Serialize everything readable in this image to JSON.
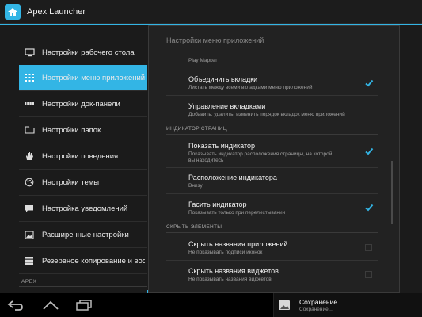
{
  "app": {
    "title": "Apex Launcher"
  },
  "sidebar": {
    "items": [
      {
        "label": "Настройки рабочего стола",
        "icon": "monitor-icon"
      },
      {
        "label": "Настройки меню приложений",
        "icon": "grid-icon"
      },
      {
        "label": "Настройки док-панели",
        "icon": "dock-icon"
      },
      {
        "label": "Настройки папок",
        "icon": "folder-icon"
      },
      {
        "label": "Настройки поведения",
        "icon": "hand-icon"
      },
      {
        "label": "Настройки темы",
        "icon": "palette-icon"
      },
      {
        "label": "Настройка уведомлений",
        "icon": "chat-bubble-icon"
      },
      {
        "label": "Расширенные настройки",
        "icon": "image-icon"
      },
      {
        "label": "Резервное копирование и восс",
        "icon": "storage-icon"
      }
    ],
    "section": "APEX"
  },
  "panel": {
    "title": "Настройки меню приложений",
    "prev_summary": "Play Маркет",
    "items": {
      "merge_tabs": {
        "title": "Объединить вкладки",
        "summary": "Листать между всеми вкладками меню приложений"
      },
      "manage_tabs": {
        "title": "Управление вкладками",
        "summary": "Добавить, удалить, изменить порядок вкладок меню приложений"
      },
      "show_indicator": {
        "title": "Показать индикатор",
        "summary": "Показывать индикатор расположения страницы, на которой вы находитесь"
      },
      "indicator_position": {
        "title": "Расположение индикатора",
        "summary": "Внизу"
      },
      "fade_indicator": {
        "title": "Гасить индикатор",
        "summary": "Показывать только при перелистывании"
      },
      "hide_app_names": {
        "title": "Скрыть названия приложений",
        "summary": "Не показывать подписи иконок"
      },
      "hide_widget_names": {
        "title": "Скрыть названия виджетов",
        "summary": "Не показывать названия виджетов"
      }
    },
    "sections": {
      "page_indicator": "ИНДИКАТОР СТРАНИЦ",
      "hide_elements": "СКРЫТЬ ЭЛЕМЕНТЫ"
    }
  },
  "notification": {
    "title": "Сохранение…",
    "subtitle": "Сохранение…"
  },
  "colors": {
    "accent": "#33b5e5",
    "background": "#1b1b1b",
    "panel": "#222222"
  }
}
